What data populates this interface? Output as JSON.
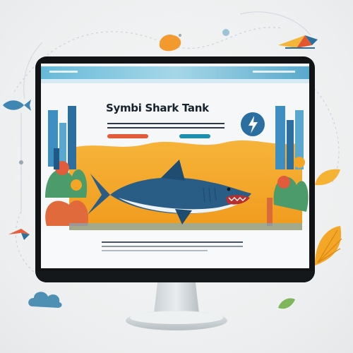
{
  "site": {
    "title": "Symbi Shark Tank"
  },
  "colors": {
    "accent_orange": "#f3a21f",
    "accent_teal": "#1f8fb0",
    "accent_red": "#e25b3a",
    "shark_blue": "#2a5d86",
    "bezel": "#111315",
    "screen_bg": "#f5f7f8"
  },
  "icons": {
    "hero_badge": "lightning-icon"
  }
}
